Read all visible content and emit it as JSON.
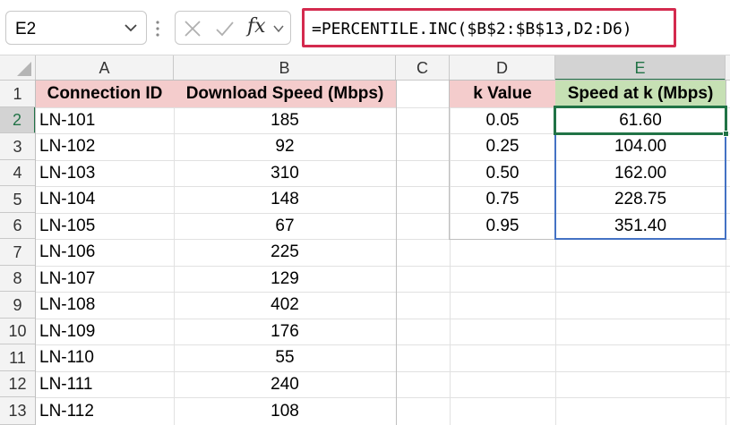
{
  "name_box": {
    "value": "E2"
  },
  "formula_bar": {
    "formula": "=PERCENTILE.INC($B$2:$B$13,D2:D6)",
    "fx_label": "fx"
  },
  "columns": [
    "A",
    "B",
    "C",
    "D",
    "E"
  ],
  "rows": [
    "1",
    "2",
    "3",
    "4",
    "5",
    "6",
    "7",
    "8",
    "9",
    "10",
    "11",
    "12",
    "13"
  ],
  "table1": {
    "headers": [
      "Connection ID",
      "Download Speed (Mbps)"
    ],
    "ids": [
      "LN-101",
      "LN-102",
      "LN-103",
      "LN-104",
      "LN-105",
      "LN-106",
      "LN-107",
      "LN-108",
      "LN-109",
      "LN-110",
      "LN-111",
      "LN-112"
    ],
    "speeds": [
      "185",
      "92",
      "310",
      "148",
      "67",
      "225",
      "129",
      "402",
      "176",
      "55",
      "240",
      "108"
    ]
  },
  "table2": {
    "headers": [
      "k Value",
      "Speed at k (Mbps)"
    ],
    "k_values": [
      "0.05",
      "0.25",
      "0.50",
      "0.75",
      "0.95"
    ],
    "results": [
      "61.60",
      "104.00",
      "162.00",
      "228.75",
      "351.40"
    ]
  },
  "colors": {
    "pink_header": "#f4cccc",
    "green_header": "#c6e0b4",
    "formula_highlight": "#d42a4e",
    "excel_green": "#217346",
    "range_blue": "#4472c4"
  }
}
